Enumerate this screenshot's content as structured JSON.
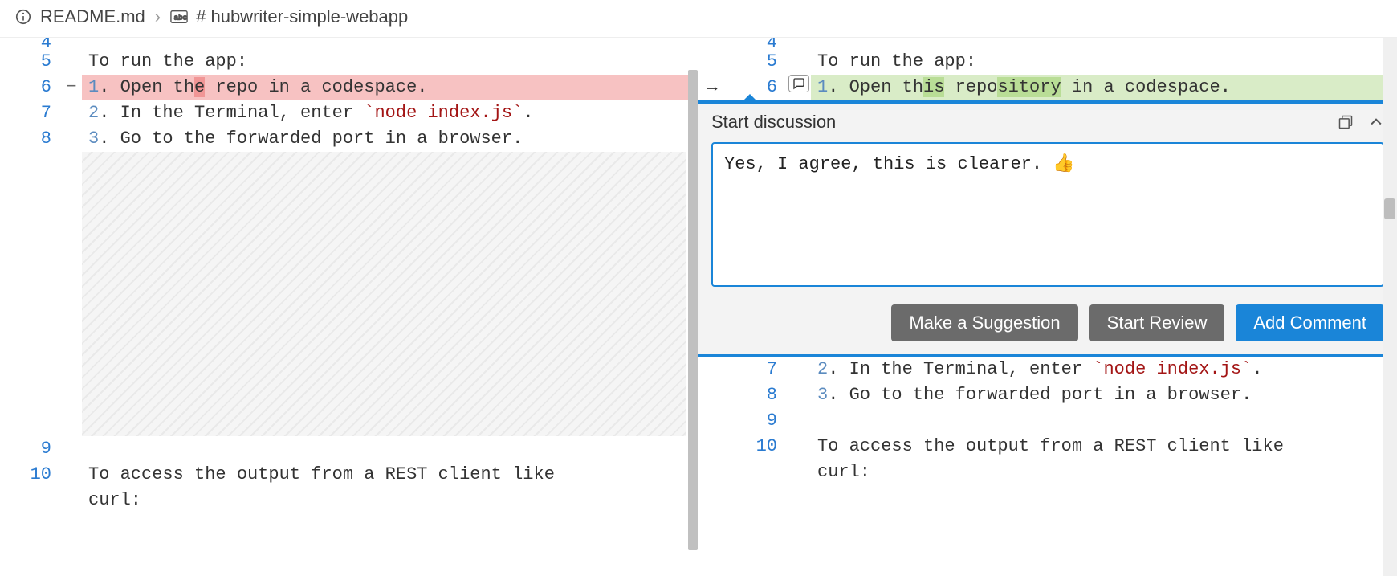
{
  "breadcrumb": {
    "file": "README.md",
    "heading": "# hubwriter-simple-webapp"
  },
  "left": {
    "lines": [
      {
        "n": "4",
        "marker": "",
        "html": "",
        "partial": true
      },
      {
        "n": "5",
        "marker": "",
        "text": "To run the app:"
      },
      {
        "n": "6",
        "marker": "−",
        "del": true,
        "prefix": "1. Open th",
        "delmark": "e",
        "mid": " repo",
        "rest": " in a codespace."
      },
      {
        "n": "7",
        "marker": "",
        "seg1": "2. In the Terminal, enter ",
        "code": "`node index.js`",
        "seg2": "."
      },
      {
        "n": "8",
        "marker": "",
        "text": "3. Go to the forwarded port in a browser."
      }
    ],
    "tail": [
      {
        "n": "9",
        "text": ""
      },
      {
        "n": "10",
        "text_a": "To access the output from a REST client like ",
        "text_b": "curl:"
      }
    ]
  },
  "right": {
    "lines_top": [
      {
        "n": "4",
        "arrow": "",
        "partial": true
      },
      {
        "n": "5",
        "arrow": "",
        "text": "To run the app:"
      },
      {
        "n": "6",
        "arrow": "→",
        "add": true,
        "comment_icon": true,
        "prefix": "1. Open th",
        "addmark1": "is",
        "mid1": " repo",
        "addmark2": "sitory",
        "rest": " in a codespace."
      }
    ],
    "lines_bottom": [
      {
        "n": "7",
        "seg1": "2. In the Terminal, enter ",
        "code": "`node index.js`",
        "seg2": "."
      },
      {
        "n": "8",
        "text": "3. Go to the forwarded port in a browser."
      },
      {
        "n": "9",
        "text": ""
      },
      {
        "n": "10",
        "text_a": "To access the output from a REST client like ",
        "text_b": "curl:"
      }
    ]
  },
  "discussion": {
    "title": "Start discussion",
    "comment_text": "Yes, I agree, this is clearer. 👍",
    "buttons": {
      "suggestion": "Make a Suggestion",
      "review": "Start Review",
      "add": "Add Comment"
    }
  }
}
